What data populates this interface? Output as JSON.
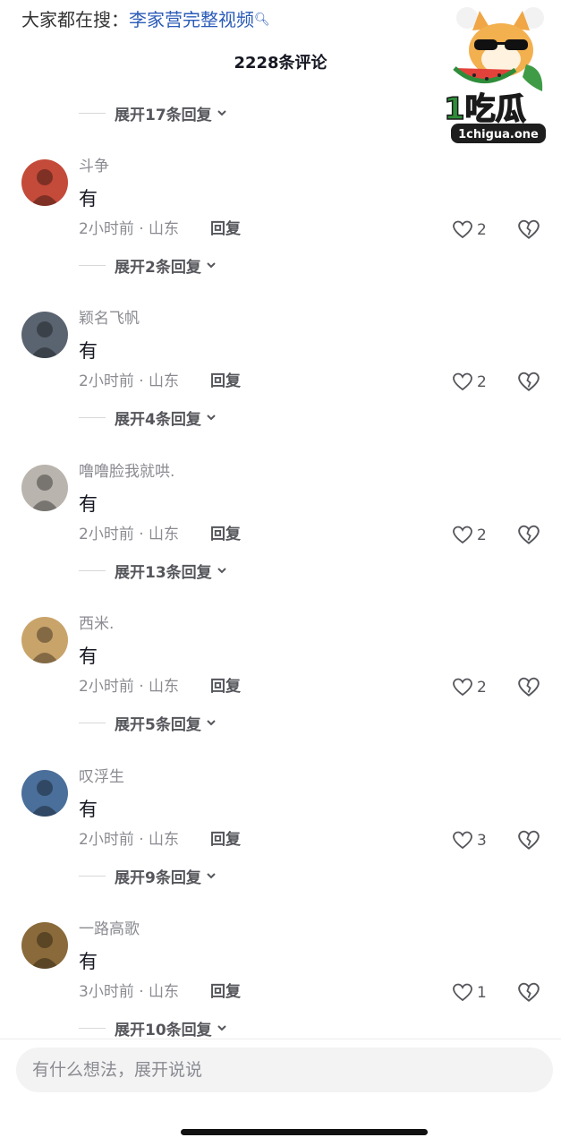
{
  "search_hint": {
    "prefix": "大家都在搜：",
    "keyword": "李家营完整视频"
  },
  "logo": {
    "brand": "1吃瓜",
    "domain": "1chigua.one"
  },
  "title": "2228条评论",
  "top_expand": "展开17条回复",
  "comments": [
    {
      "user": "斗争",
      "text": "有",
      "meta": "2小时前 · 山东",
      "reply": "回复",
      "likes": "2",
      "expand": "展开2条回复",
      "avatar_color": "#c44a3a"
    },
    {
      "user": "颖名飞帆",
      "text": "有",
      "meta": "2小时前 · 山东",
      "reply": "回复",
      "likes": "2",
      "expand": "展开4条回复",
      "avatar_color": "#5a6470"
    },
    {
      "user": "噜噜脸我就哄.",
      "text": "有",
      "meta": "2小时前 · 山东",
      "reply": "回复",
      "likes": "2",
      "expand": "展开13条回复",
      "avatar_color": "#b9b4ad"
    },
    {
      "user": "西米.",
      "text": "有",
      "meta": "2小时前 · 山东",
      "reply": "回复",
      "likes": "2",
      "expand": "展开5条回复",
      "avatar_color": "#c9a46a"
    },
    {
      "user": "叹浮生",
      "text": "有",
      "meta": "2小时前 · 山东",
      "reply": "回复",
      "likes": "3",
      "expand": "展开9条回复",
      "avatar_color": "#4a6f9a"
    },
    {
      "user": "一路高歌",
      "text": "有",
      "meta": "3小时前 · 山东",
      "reply": "回复",
      "likes": "1",
      "expand": "展开10条回复",
      "avatar_color": "#8a6a3a"
    }
  ],
  "input": {
    "placeholder": "有什么想法，展开说说"
  },
  "colors": {
    "link": "#2b5bb8",
    "muted": "#8a8b91",
    "text": "#161823"
  }
}
